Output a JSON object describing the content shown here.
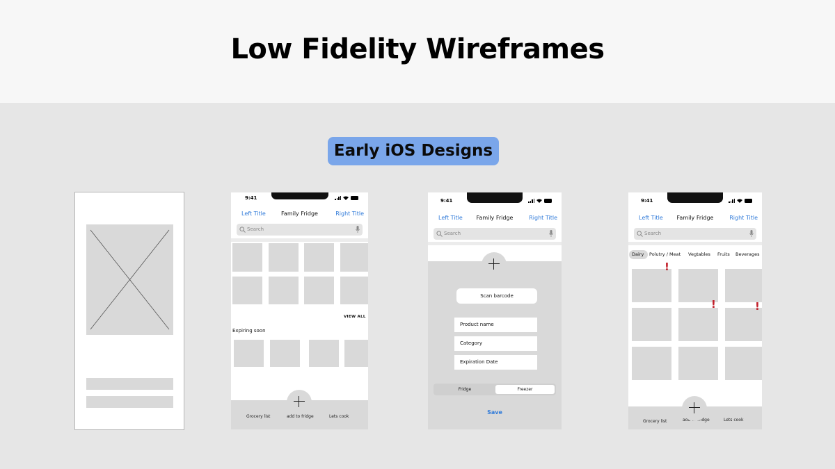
{
  "page": {
    "title": "Low Fidelity Wireframes",
    "badge": "Early iOS Designs"
  },
  "status_bar": {
    "time": "9:41"
  },
  "wireframe_2": {
    "nav": {
      "left": "Left Title",
      "center": "Family Fridge",
      "right": "Right Title"
    },
    "search_placeholder": "Search",
    "view_all": "VIEW ALL",
    "expiring_label": "Expiring soon",
    "tabs": [
      "Grocery list",
      "add to fridge",
      "Lets cook"
    ]
  },
  "wireframe_3": {
    "nav": {
      "left": "Left Title",
      "center": "Family Fridge",
      "right": "Right Title"
    },
    "search_placeholder": "Search",
    "scan_button": "Scan barcode",
    "fields": [
      "Product name",
      "Category",
      "Expiration Date"
    ],
    "segments": [
      "Fridge",
      "Freezer"
    ],
    "selected_segment": "Freezer",
    "save": "Save"
  },
  "wireframe_4": {
    "nav": {
      "left": "Left Title",
      "center": "Family Fridge",
      "right": "Right Title"
    },
    "search_placeholder": "Search",
    "categories": [
      "Dairy",
      "Polutry / Meat",
      "Vegtables",
      "Fruits",
      "Beverages"
    ],
    "selected_category": "Dairy",
    "alert_symbol": "!",
    "tabs": [
      "Grocery list",
      "add to fridge",
      "Lets cook"
    ]
  },
  "colors": {
    "accent_blue": "#2f7ad9",
    "badge_bg": "#7aa6ea",
    "placeholder_gray": "#d9d9d9",
    "alert_red": "#c21f2a"
  },
  "icons": [
    "search-icon",
    "mic-icon",
    "plus-icon",
    "signal-icon",
    "wifi-icon",
    "battery-icon",
    "image-placeholder-icon"
  ]
}
